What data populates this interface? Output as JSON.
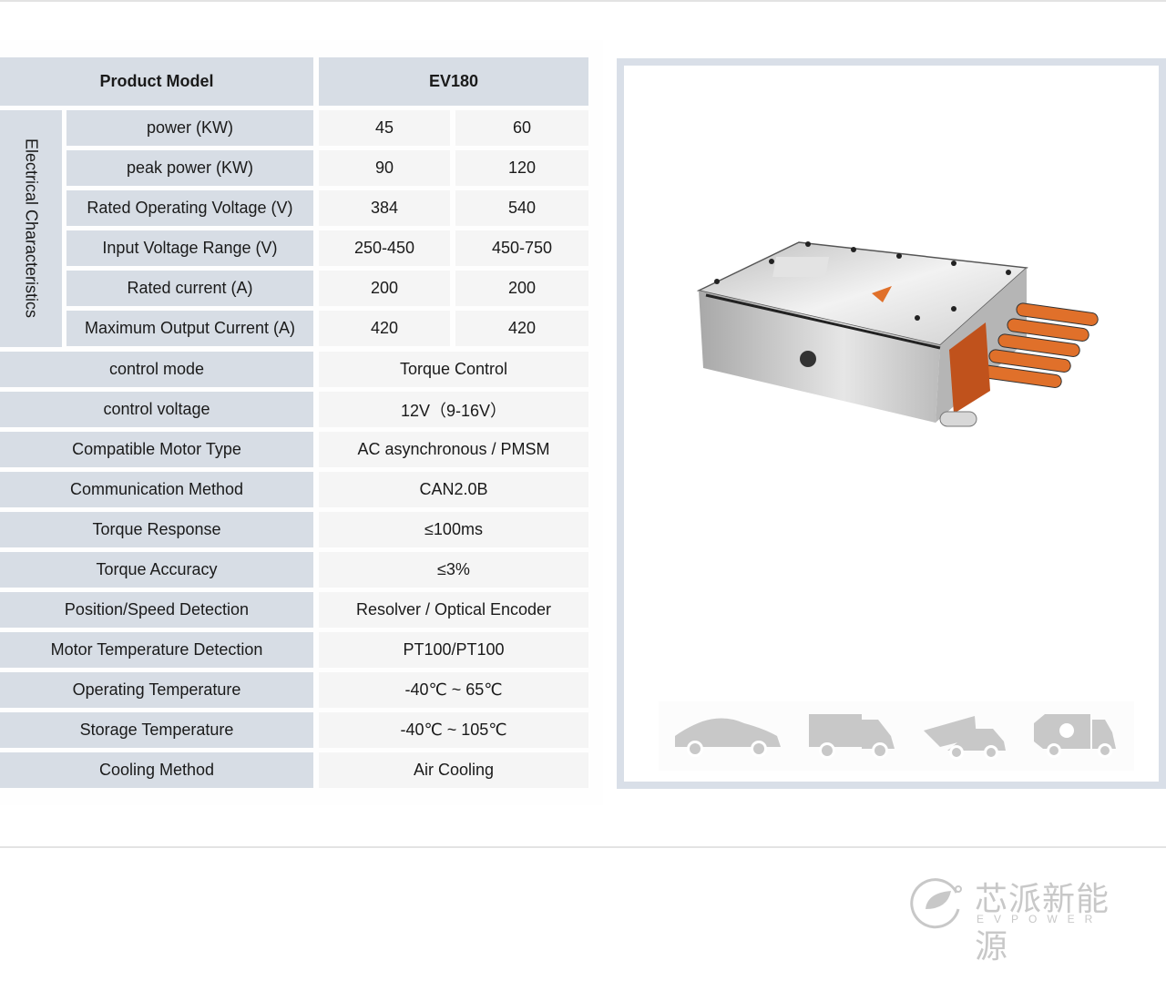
{
  "spec_table": {
    "header": {
      "label": "Product Model",
      "value": "EV180"
    },
    "group": {
      "label": "Electrical Characteristics",
      "rows": [
        {
          "label": "power (KW)",
          "values": [
            "45",
            "60"
          ]
        },
        {
          "label": "peak power (KW)",
          "values": [
            "90",
            "120"
          ]
        },
        {
          "label": "Rated Operating Voltage (V)",
          "values": [
            "384",
            "540"
          ]
        },
        {
          "label": "Input Voltage Range (V)",
          "values": [
            "250-450",
            "450-750"
          ]
        },
        {
          "label": "Rated current (A)",
          "values": [
            "200",
            "200"
          ]
        },
        {
          "label": "Maximum Output Current (A)",
          "values": [
            "420",
            "420"
          ]
        }
      ]
    },
    "rows": [
      {
        "label": "control mode",
        "value": "Torque Control"
      },
      {
        "label": "control voltage",
        "value": "12V（9-16V）"
      },
      {
        "label": "Compatible Motor Type",
        "value": "AC asynchronous  /  PMSM"
      },
      {
        "label": "Communication Method",
        "value": "CAN2.0B"
      },
      {
        "label": "Torque Response",
        "value": "≤100ms"
      },
      {
        "label": "Torque Accuracy",
        "value": "≤3%"
      },
      {
        "label": "Position/Speed Detection",
        "value": "Resolver / Optical Encoder"
      },
      {
        "label": "Motor Temperature Detection",
        "value": "PT100/PT100"
      },
      {
        "label": "Operating Temperature",
        "value": "-40℃ ~ 65℃"
      },
      {
        "label": "Storage Temperature",
        "value": "-40℃ ~ 105℃"
      },
      {
        "label": "Cooling Method",
        "value": "Air Cooling"
      }
    ]
  },
  "product_panel": {
    "image": "motor-controller-product-render",
    "applications": [
      {
        "icon": "car-icon",
        "label": "passenger car"
      },
      {
        "icon": "cargo-truck-icon",
        "label": "cargo truck"
      },
      {
        "icon": "dump-truck-icon",
        "label": "dump truck"
      },
      {
        "icon": "garbage-truck-icon",
        "label": "recycling truck"
      }
    ]
  },
  "brand": {
    "name_cn": "芯派新能源",
    "name_en": "EVPOWER"
  },
  "colors": {
    "label_bg": "#d7dde5",
    "value_bg": "#f5f5f5",
    "panel_border": "#d9dfe8",
    "icon_gray": "#c8c8c8",
    "connector_orange": "#e0702a"
  }
}
